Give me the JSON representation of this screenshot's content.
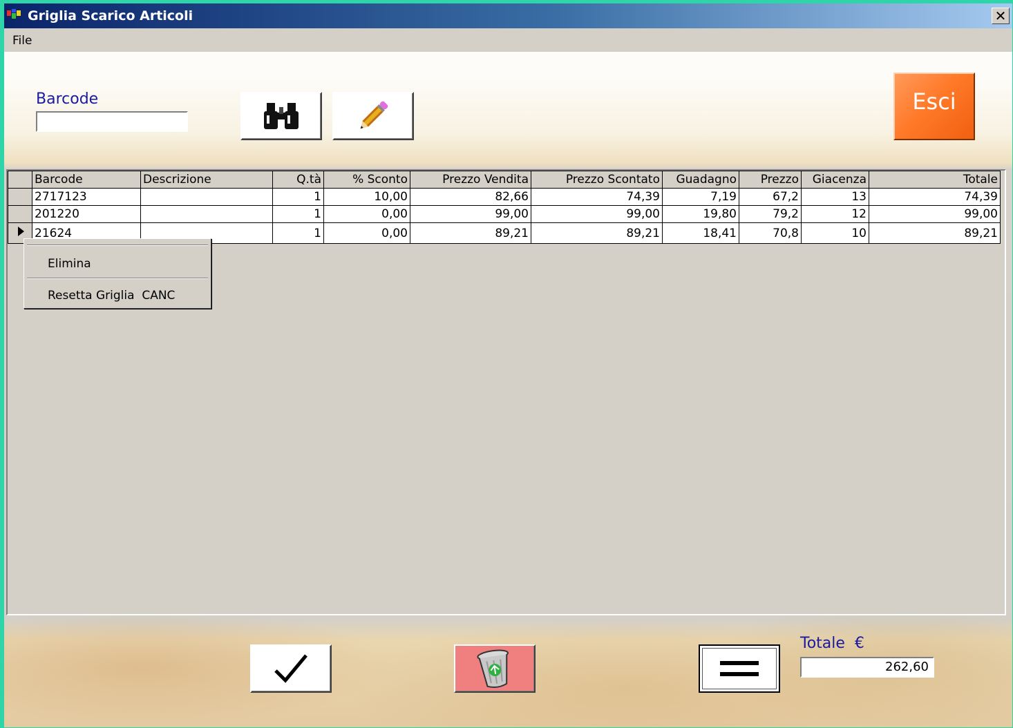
{
  "window": {
    "title": "Griglia Scarico Articoli",
    "close_label": "✕"
  },
  "menu": {
    "file": "File"
  },
  "search": {
    "label": "Barcode",
    "value": ""
  },
  "toolbar": {
    "find_icon": "binoculars-icon",
    "edit_icon": "pencil-icon",
    "exit_label": "Esci"
  },
  "grid": {
    "columns": [
      "Barcode",
      "Descrizione",
      "Q.tà",
      "% Sconto",
      "Prezzo Vendita",
      "Prezzo Scontato",
      "Guadagno",
      "Prezzo",
      "Giacenza",
      "Totale"
    ],
    "rows": [
      [
        "2717123",
        "",
        "1",
        "10,00",
        "82,66",
        "74,39",
        "7,19",
        "67,2",
        "13",
        "74,39"
      ],
      [
        "201220",
        "",
        "1",
        "0,00",
        "99,00",
        "99,00",
        "19,80",
        "79,2",
        "12",
        "99,00"
      ],
      [
        "21624",
        "",
        "1",
        "0,00",
        "89,21",
        "89,21",
        "18,41",
        "70,8",
        "10",
        "89,21"
      ]
    ],
    "current_row": 2
  },
  "context_menu": {
    "items": [
      "Elimina",
      "Resetta Griglia  CANC"
    ]
  },
  "bottom": {
    "confirm_icon": "checkmark-icon",
    "delete_icon": "recycle-bin-icon",
    "equals_icon": "equals-icon",
    "total_label": "Totale  €",
    "total_value": "262,60"
  },
  "colors": {
    "exit_button": "#ff7a2a",
    "delete_button": "#f08080",
    "label_blue": "#1a1aa0",
    "titlebar": "#0a246a"
  }
}
